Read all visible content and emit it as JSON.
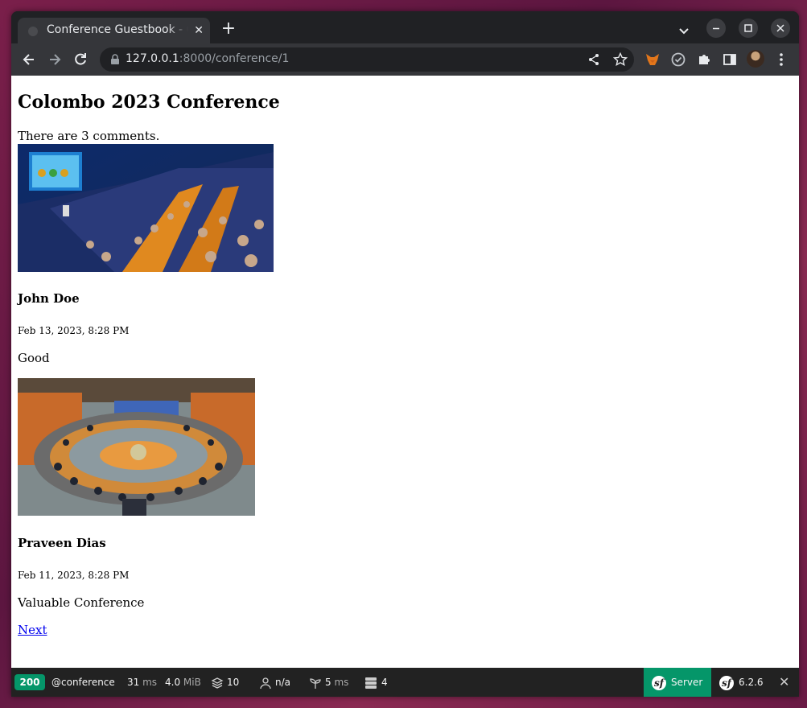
{
  "browser": {
    "tab_title": "Conference Guestbook - Conference Guestbook",
    "tab_close": "✕",
    "new_tab": "+",
    "url_host": "127.0.0.1",
    "url_path": ":8000/conference/1"
  },
  "page": {
    "title": "Colombo 2023 Conference",
    "comment_count_text": "There are 3 comments.",
    "comments": [
      {
        "author": "John Doe",
        "date": "Feb 13, 2023, 8:28 PM",
        "text": "Good"
      },
      {
        "author": "Praveen Dias",
        "date": "Feb 11, 2023, 8:28 PM",
        "text": "Valuable Conference"
      }
    ],
    "next_link": "Next"
  },
  "profiler": {
    "status_code": "200",
    "route": "@conference",
    "time_value": "31",
    "time_unit": "ms",
    "memory_value": "4.0",
    "memory_unit": "MiB",
    "twig_count": "10",
    "user": "n/a",
    "events_value": "5",
    "events_unit": "ms",
    "db_queries": "4",
    "server_label": "Server",
    "symfony_version": "6.2.6",
    "close": "✕"
  },
  "icons": {
    "back": "arrow-left-icon",
    "forward": "arrow-right-icon",
    "reload": "reload-icon",
    "lock": "lock-icon",
    "share": "share-icon",
    "bookmark": "star-icon",
    "metamask": "fox-extension-icon",
    "extension2": "circle-check-extension-icon",
    "extensions": "puzzle-icon",
    "sidepanel": "side-panel-icon",
    "menu": "kebab-menu-icon"
  },
  "colors": {
    "profiler_success": "#059669",
    "link": "#0000ee"
  }
}
